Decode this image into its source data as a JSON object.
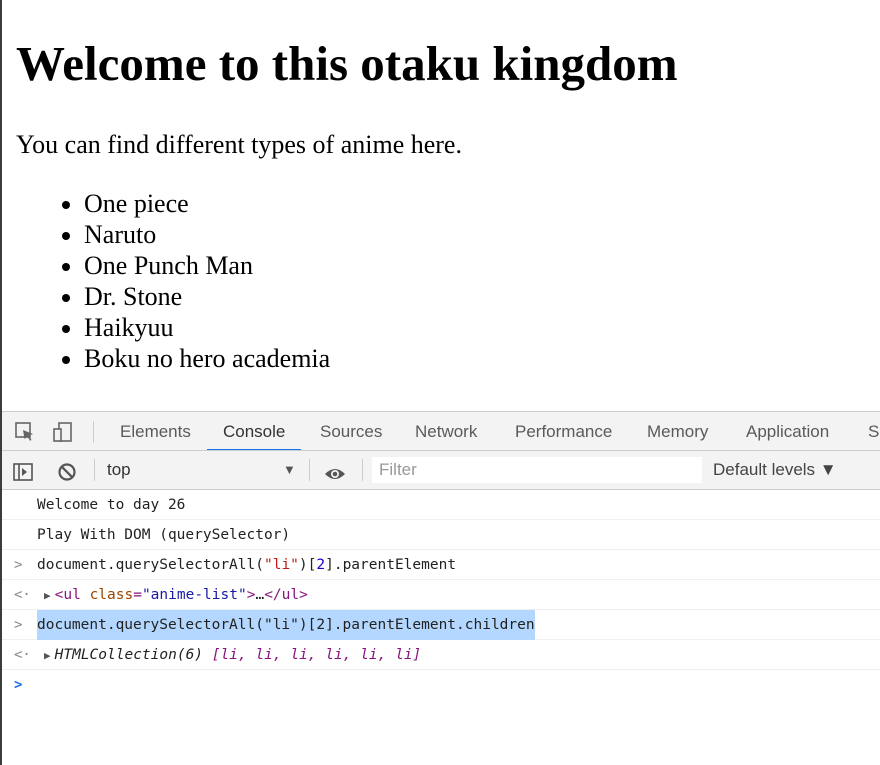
{
  "page": {
    "heading": "Welcome to this otaku kingdom",
    "intro": "You can find different types of anime here.",
    "anime_list": [
      "One piece",
      "Naruto",
      "One Punch Man",
      "Dr. Stone",
      "Haikyuu",
      "Boku no hero academia"
    ]
  },
  "devtools": {
    "tabs": [
      "Elements",
      "Console",
      "Sources",
      "Network",
      "Performance",
      "Memory",
      "Application",
      "Se"
    ],
    "active_tab": "Console",
    "toolbar": {
      "context": "top",
      "context_arrow": "▼",
      "filter_placeholder": "Filter",
      "levels": "Default levels ▼"
    },
    "console": {
      "log1": "Welcome to day 26",
      "log2": "Play With DOM (querySelector)",
      "cmd1": {
        "prompt": ">",
        "pre": "document.querySelectorAll(",
        "arg": "\"li\"",
        "mid": ")[",
        "idx": "2",
        "post": "].parentElement"
      },
      "res1": {
        "prompt": "<·",
        "tri": "▶",
        "tag_open": "<ul",
        "attr_name": "class",
        "eq": "=",
        "attr_val": "\"anime-list\"",
        "close_bracket": ">",
        "ellipsis": "…",
        "tag_close": "</ul>"
      },
      "cmd2": {
        "prompt": ">",
        "text": "document.querySelectorAll(\"li\")[2].parentElement.children"
      },
      "res2": {
        "prompt": "<·",
        "tri": "▶",
        "text": "HTMLCollection(6) ",
        "items": "[li, li, li, li, li, li]"
      },
      "input_prompt": ">"
    }
  }
}
